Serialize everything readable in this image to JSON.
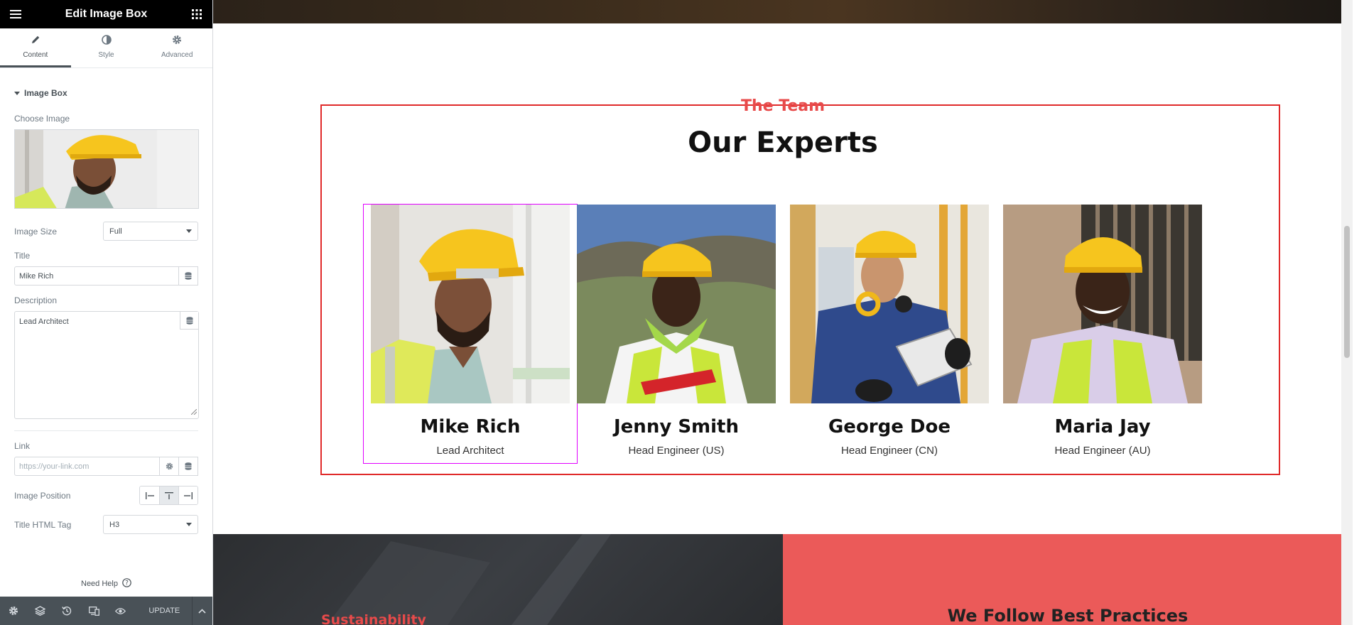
{
  "panel": {
    "header_title": "Edit Image Box",
    "tabs": [
      {
        "label": "Content",
        "icon": "pencil-icon",
        "active": true
      },
      {
        "label": "Style",
        "icon": "contrast-icon",
        "active": false
      },
      {
        "label": "Advanced",
        "icon": "gear-icon",
        "active": false
      }
    ],
    "section_title": "Image Box",
    "choose_image_label": "Choose Image",
    "image_size_label": "Image Size",
    "image_size_value": "Full",
    "title_label": "Title",
    "title_value": "Mike Rich",
    "description_label": "Description",
    "description_value": "Lead Architect",
    "link_label": "Link",
    "link_placeholder": "https://your-link.com",
    "image_position_label": "Image Position",
    "image_position_selected": "top",
    "title_tag_label": "Title HTML Tag",
    "title_tag_value": "H3",
    "need_help": "Need Help",
    "update_label": "UPDATE"
  },
  "preview": {
    "eyebrow": "The Team",
    "heading": "Our Experts",
    "members": [
      {
        "name": "Mike Rich",
        "role": "Lead Architect"
      },
      {
        "name": "Jenny Smith",
        "role": "Head Engineer (US)"
      },
      {
        "name": "George Doe",
        "role": "Head Engineer (CN)"
      },
      {
        "name": "Maria Jay",
        "role": "Head Engineer (AU)"
      }
    ],
    "sustainability": "Sustainability",
    "best_practices": "We Follow Best Practices"
  },
  "colors": {
    "accent_red": "#e84a4a",
    "selection_magenta": "#e100ff",
    "panel_dark": "#000000",
    "footer_gray": "#495157",
    "helmet_yellow": "#f5c518"
  }
}
